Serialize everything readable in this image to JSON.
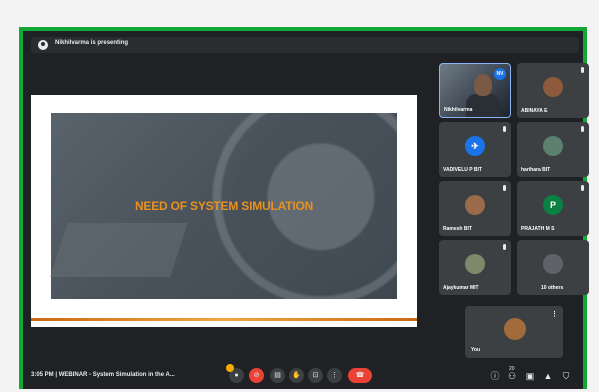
{
  "presenting_bar": {
    "text": "Nikhilvarma is presenting"
  },
  "slide": {
    "title": "NEED OF SYSTEM SIMULATION"
  },
  "participants": [
    {
      "name": "Nikhilvarma",
      "video": true,
      "badge": "NV"
    },
    {
      "name": "ABINAYA E"
    },
    {
      "name": "VADIVELU P BIT",
      "avatar_color": "#1a73e8"
    },
    {
      "name": "harihara BIT"
    },
    {
      "name": "Ramesh BIT"
    },
    {
      "name": "PRAJATH M S",
      "avatar_letter": "P",
      "avatar_color": "#0b8043"
    },
    {
      "name": "Ajaykumar MIT"
    },
    {
      "name": "10 others"
    }
  ],
  "self_tile": {
    "name": "You",
    "more": "⋮"
  },
  "control_bar": {
    "time": "3:05 PM",
    "separator": "|",
    "meeting_title": "WEBINAR - System Simulation in the A...",
    "participant_count": "20"
  },
  "colors": {
    "frame_border": "#12a835",
    "accent_orange": "#e8911f",
    "end_call": "#ea4335"
  }
}
